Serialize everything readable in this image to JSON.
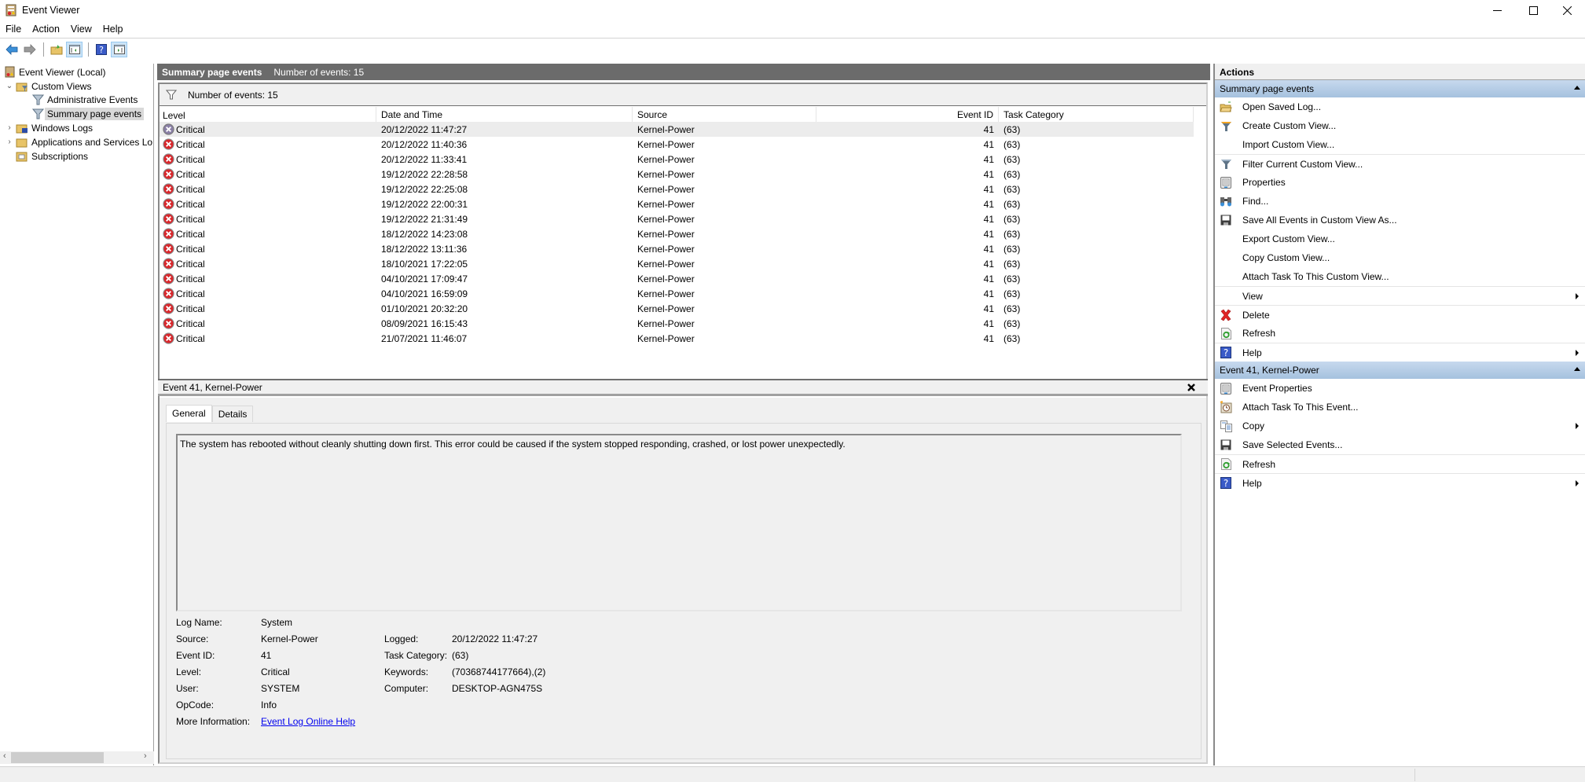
{
  "window": {
    "title": "Event Viewer",
    "icon": "event-viewer-icon",
    "controls": [
      "minimize",
      "maximize",
      "close"
    ]
  },
  "menubar": [
    "File",
    "Action",
    "View",
    "Help"
  ],
  "toolbar": [
    {
      "name": "back-icon"
    },
    {
      "name": "forward-icon"
    },
    {
      "name": "up-folder-icon"
    },
    {
      "name": "show-hide-console-tree-icon"
    },
    {
      "name": "help-icon"
    },
    {
      "name": "show-hide-action-pane-icon"
    }
  ],
  "tree": {
    "items": [
      {
        "label": "Event Viewer (Local)",
        "level": 0,
        "expander": ""
      },
      {
        "label": "Custom Views",
        "level": 0,
        "expander": "expanded"
      },
      {
        "label": "Administrative Events",
        "level": 1,
        "expander": ""
      },
      {
        "label": "Summary page events",
        "level": 1,
        "expander": "",
        "selected": true
      },
      {
        "label": "Windows Logs",
        "level": 0,
        "expander": "collapsed"
      },
      {
        "label": "Applications and Services Lo",
        "level": 0,
        "expander": "collapsed"
      },
      {
        "label": "Subscriptions",
        "level": 0,
        "expander": ""
      }
    ]
  },
  "center": {
    "header_title": "Summary page events",
    "header_count": "Number of events: 15",
    "filter_text": "Number of events: 15",
    "columns": [
      "Level",
      "Date and Time",
      "Source",
      "Event ID",
      "Task Category"
    ],
    "rows": [
      {
        "level": "Critical",
        "date": "20/12/2022 11:47:27",
        "source": "Kernel-Power",
        "event_id": "41",
        "task": "(63)",
        "selected": true
      },
      {
        "level": "Critical",
        "date": "20/12/2022 11:40:36",
        "source": "Kernel-Power",
        "event_id": "41",
        "task": "(63)"
      },
      {
        "level": "Critical",
        "date": "20/12/2022 11:33:41",
        "source": "Kernel-Power",
        "event_id": "41",
        "task": "(63)"
      },
      {
        "level": "Critical",
        "date": "19/12/2022 22:28:58",
        "source": "Kernel-Power",
        "event_id": "41",
        "task": "(63)"
      },
      {
        "level": "Critical",
        "date": "19/12/2022 22:25:08",
        "source": "Kernel-Power",
        "event_id": "41",
        "task": "(63)"
      },
      {
        "level": "Critical",
        "date": "19/12/2022 22:00:31",
        "source": "Kernel-Power",
        "event_id": "41",
        "task": "(63)"
      },
      {
        "level": "Critical",
        "date": "19/12/2022 21:31:49",
        "source": "Kernel-Power",
        "event_id": "41",
        "task": "(63)"
      },
      {
        "level": "Critical",
        "date": "18/12/2022 14:23:08",
        "source": "Kernel-Power",
        "event_id": "41",
        "task": "(63)"
      },
      {
        "level": "Critical",
        "date": "18/12/2022 13:11:36",
        "source": "Kernel-Power",
        "event_id": "41",
        "task": "(63)"
      },
      {
        "level": "Critical",
        "date": "18/10/2021 17:22:05",
        "source": "Kernel-Power",
        "event_id": "41",
        "task": "(63)"
      },
      {
        "level": "Critical",
        "date": "04/10/2021 17:09:47",
        "source": "Kernel-Power",
        "event_id": "41",
        "task": "(63)"
      },
      {
        "level": "Critical",
        "date": "04/10/2021 16:59:09",
        "source": "Kernel-Power",
        "event_id": "41",
        "task": "(63)"
      },
      {
        "level": "Critical",
        "date": "01/10/2021 20:32:20",
        "source": "Kernel-Power",
        "event_id": "41",
        "task": "(63)"
      },
      {
        "level": "Critical",
        "date": "08/09/2021 16:15:43",
        "source": "Kernel-Power",
        "event_id": "41",
        "task": "(63)"
      },
      {
        "level": "Critical",
        "date": "21/07/2021 11:46:07",
        "source": "Kernel-Power",
        "event_id": "41",
        "task": "(63)"
      }
    ]
  },
  "detail": {
    "title": "Event 41, Kernel-Power",
    "tabs": [
      "General",
      "Details"
    ],
    "active_tab": "General",
    "description": "The system has rebooted without cleanly shutting down first. This error could be caused if the system stopped responding, crashed, or lost power unexpectedly.",
    "props": {
      "log_name_label": "Log Name:",
      "log_name": "System",
      "source_label": "Source:",
      "source": "Kernel-Power",
      "logged_label": "Logged:",
      "logged": "20/12/2022 11:47:27",
      "event_id_label": "Event ID:",
      "event_id": "41",
      "task_label": "Task Category:",
      "task": "(63)",
      "level_label": "Level:",
      "level": "Critical",
      "keywords_label": "Keywords:",
      "keywords": "(70368744177664),(2)",
      "user_label": "User:",
      "user": "SYSTEM",
      "computer_label": "Computer:",
      "computer": "DESKTOP-AGN475S",
      "opcode_label": "OpCode:",
      "opcode": "Info",
      "more_info_label": "More Information:",
      "more_info_link": "Event Log Online Help"
    }
  },
  "actions": {
    "header": "Actions",
    "sections": [
      {
        "title": "Summary page events",
        "items": [
          {
            "label": "Open Saved Log...",
            "icon": "open-folder-icon"
          },
          {
            "label": "Create Custom View...",
            "icon": "create-filter-icon"
          },
          {
            "label": "Import Custom View...",
            "icon": ""
          },
          {
            "label": "Filter Current Custom View...",
            "icon": "filter-icon",
            "sep": true
          },
          {
            "label": "Properties",
            "icon": "properties-icon"
          },
          {
            "label": "Find...",
            "icon": "binoculars-icon"
          },
          {
            "label": "Save All Events in Custom View As...",
            "icon": "save-disk-icon"
          },
          {
            "label": "Export Custom View...",
            "icon": ""
          },
          {
            "label": "Copy Custom View...",
            "icon": ""
          },
          {
            "label": "Attach Task To This Custom View...",
            "icon": ""
          },
          {
            "label": "View",
            "icon": "",
            "sep": true,
            "submenu": true
          },
          {
            "label": "Delete",
            "icon": "delete-icon",
            "sep": true
          },
          {
            "label": "Refresh",
            "icon": "refresh-icon"
          },
          {
            "label": "Help",
            "icon": "help-icon",
            "sep": true,
            "submenu": true
          }
        ]
      },
      {
        "title": "Event 41, Kernel-Power",
        "items": [
          {
            "label": "Event Properties",
            "icon": "properties-icon"
          },
          {
            "label": "Attach Task To This Event...",
            "icon": "task-clock-icon"
          },
          {
            "label": "Copy",
            "icon": "copy-icon",
            "submenu": true
          },
          {
            "label": "Save Selected Events...",
            "icon": "save-disk-icon"
          },
          {
            "label": "Refresh",
            "icon": "refresh-icon",
            "sep": true
          },
          {
            "label": "Help",
            "icon": "help-icon",
            "sep": true,
            "submenu": true
          }
        ]
      }
    ]
  },
  "colors": {
    "critical_red": "#d9262b",
    "header_gray": "#6b6b6b",
    "section_blue": "#b4cde6",
    "link_blue": "#0000ee"
  }
}
